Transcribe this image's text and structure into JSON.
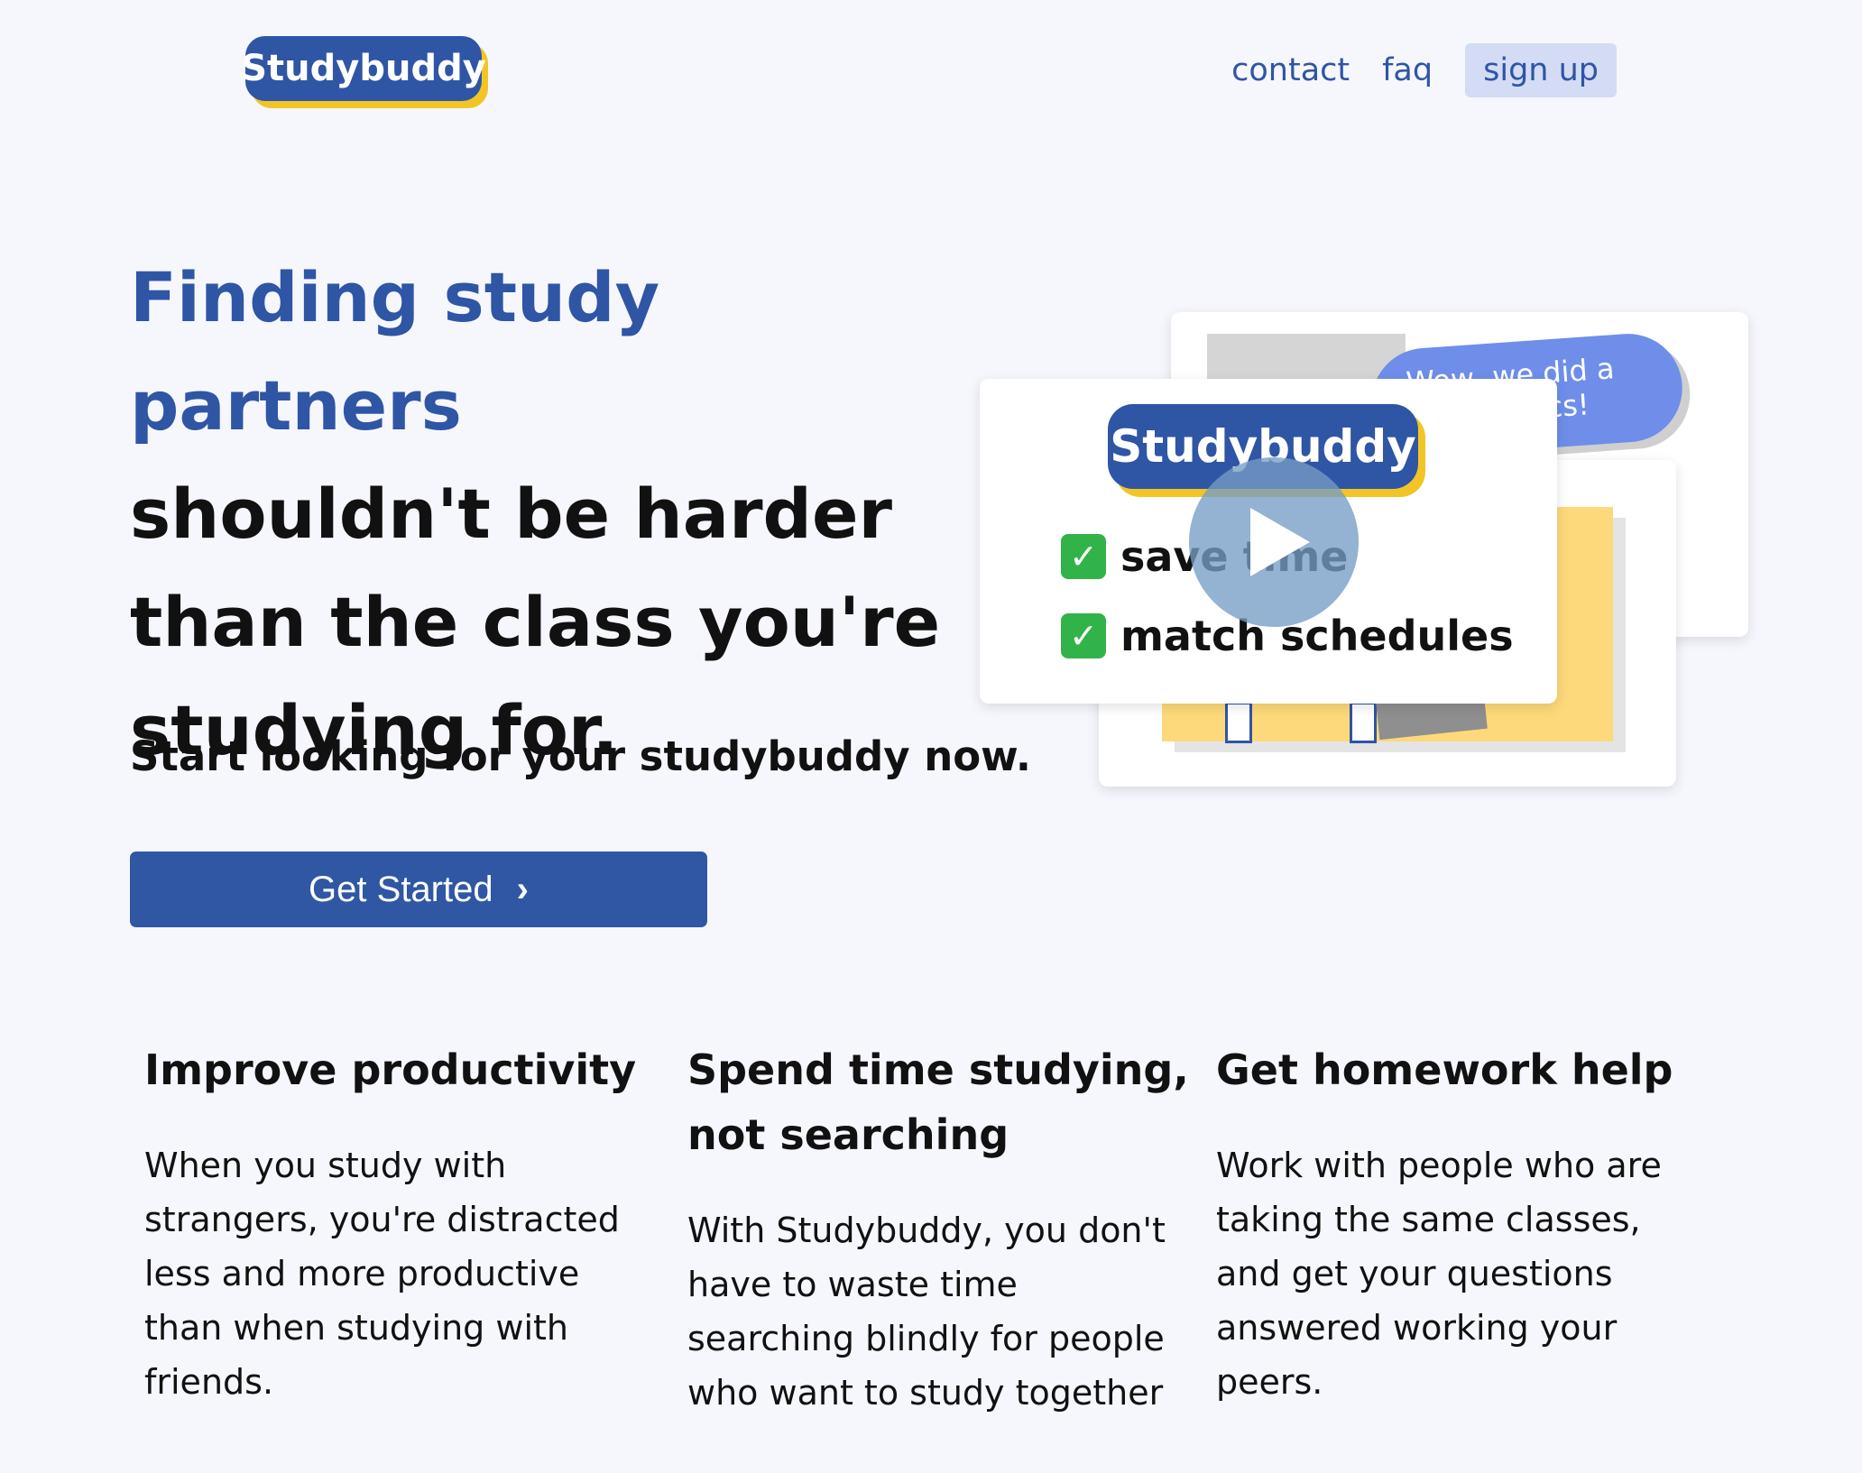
{
  "header": {
    "logo_text": "Studybuddy",
    "nav": {
      "contact": "contact",
      "faq": "faq",
      "signup": "sign up"
    }
  },
  "hero": {
    "title_accent": "Finding study partners",
    "title_rest": "shouldn't be harder than the class you're studying for.",
    "subtitle": "Start looking for your studybuddy now.",
    "cta_label": "Get Started",
    "cta_icon": "chevron-right-icon"
  },
  "video": {
    "logo_text": "Studybuddy",
    "checks": [
      "save time",
      "match schedules"
    ],
    "bubble_text": "Wow, we did a lot of topics!",
    "play_icon": "play-icon"
  },
  "features": [
    {
      "title": "Improve productivity",
      "body": "When you study with strangers, you're distracted less and more productive than when studying with friends."
    },
    {
      "title": "Spend time studying, not searching",
      "body": "With Studybuddy, you don't have to waste time searching blindly for people who want to study together"
    },
    {
      "title": "Get homework help",
      "body": "Work with people who are taking the same classes, and get your questions answered working your peers."
    }
  ],
  "colors": {
    "brand": "#2f55a5",
    "accent": "#f2c526",
    "background": "#f6f7fd"
  }
}
